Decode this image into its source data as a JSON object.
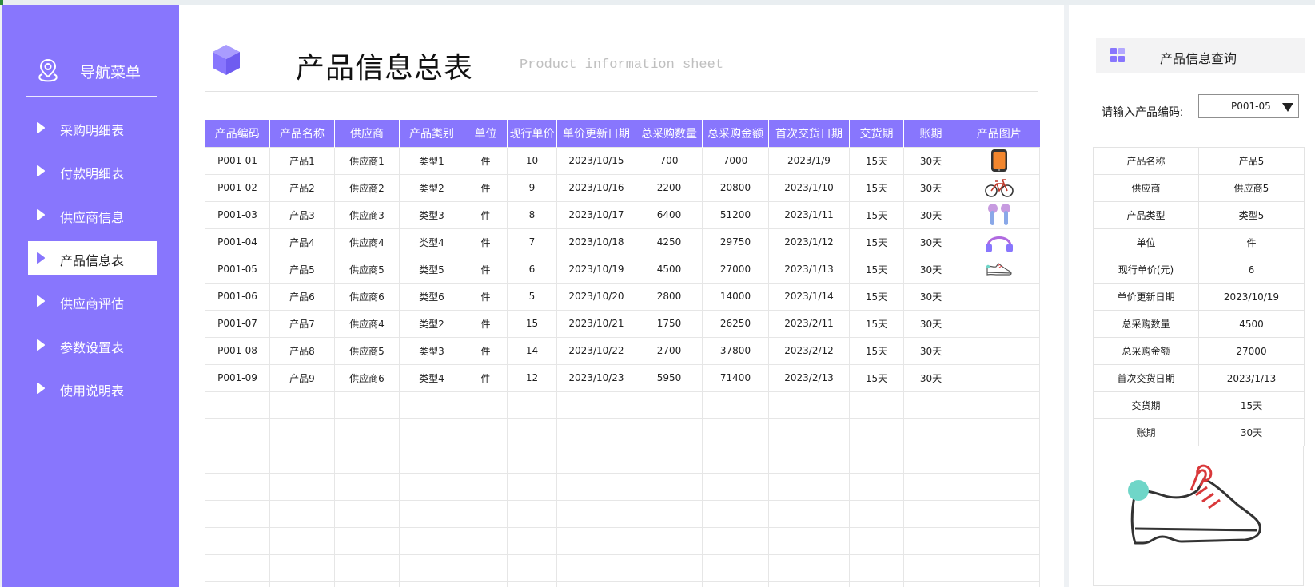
{
  "sidebar": {
    "title": "导航菜单",
    "items": [
      {
        "label": "采购明细表",
        "active": false
      },
      {
        "label": "付款明细表",
        "active": false
      },
      {
        "label": "供应商信息",
        "active": false
      },
      {
        "label": "产品信息表",
        "active": true
      },
      {
        "label": "供应商评估",
        "active": false
      },
      {
        "label": "参数设置表",
        "active": false
      },
      {
        "label": "使用说明表",
        "active": false
      }
    ]
  },
  "header": {
    "title": "产品信息总表",
    "subtitle": "Product information sheet"
  },
  "table": {
    "columns": [
      "产品编码",
      "产品名称",
      "供应商",
      "产品类别",
      "单位",
      "现行单价",
      "单价更新日期",
      "总采购数量",
      "总采购金额",
      "首次交货日期",
      "交货期",
      "账期",
      "产品图片"
    ],
    "rows": [
      {
        "code": "P001-01",
        "name": "产品1",
        "supplier": "供应商1",
        "category": "类型1",
        "unit": "件",
        "price": "10",
        "updated": "2023/10/15",
        "qty": "700",
        "amount": "7000",
        "first_delivery": "2023/1/9",
        "lead": "15天",
        "terms": "30天",
        "image": "phone-icon"
      },
      {
        "code": "P001-02",
        "name": "产品2",
        "supplier": "供应商2",
        "category": "类型2",
        "unit": "件",
        "price": "9",
        "updated": "2023/10/16",
        "qty": "2200",
        "amount": "20800",
        "first_delivery": "2023/1/10",
        "lead": "15天",
        "terms": "30天",
        "image": "bicycle-icon"
      },
      {
        "code": "P001-03",
        "name": "产品3",
        "supplier": "供应商3",
        "category": "类型3",
        "unit": "件",
        "price": "8",
        "updated": "2023/10/17",
        "qty": "6400",
        "amount": "51200",
        "first_delivery": "2023/1/11",
        "lead": "15天",
        "terms": "30天",
        "image": "earbuds-icon"
      },
      {
        "code": "P001-04",
        "name": "产品4",
        "supplier": "供应商4",
        "category": "类型4",
        "unit": "件",
        "price": "7",
        "updated": "2023/10/18",
        "qty": "4250",
        "amount": "29750",
        "first_delivery": "2023/1/12",
        "lead": "15天",
        "terms": "30天",
        "image": "headphones-icon"
      },
      {
        "code": "P001-05",
        "name": "产品5",
        "supplier": "供应商5",
        "category": "类型5",
        "unit": "件",
        "price": "6",
        "updated": "2023/10/19",
        "qty": "4500",
        "amount": "27000",
        "first_delivery": "2023/1/13",
        "lead": "15天",
        "terms": "30天",
        "image": "shoe-icon"
      },
      {
        "code": "P001-06",
        "name": "产品6",
        "supplier": "供应商6",
        "category": "类型6",
        "unit": "件",
        "price": "5",
        "updated": "2023/10/20",
        "qty": "2800",
        "amount": "14000",
        "first_delivery": "2023/1/14",
        "lead": "15天",
        "terms": "30天",
        "image": ""
      },
      {
        "code": "P001-07",
        "name": "产品7",
        "supplier": "供应商4",
        "category": "类型2",
        "unit": "件",
        "price": "15",
        "updated": "2023/10/21",
        "qty": "1750",
        "amount": "26250",
        "first_delivery": "2023/2/11",
        "lead": "15天",
        "terms": "30天",
        "image": ""
      },
      {
        "code": "P001-08",
        "name": "产品8",
        "supplier": "供应商5",
        "category": "类型3",
        "unit": "件",
        "price": "14",
        "updated": "2023/10/22",
        "qty": "2700",
        "amount": "37800",
        "first_delivery": "2023/2/12",
        "lead": "15天",
        "terms": "30天",
        "image": ""
      },
      {
        "code": "P001-09",
        "name": "产品9",
        "supplier": "供应商6",
        "category": "类型4",
        "unit": "件",
        "price": "12",
        "updated": "2023/10/23",
        "qty": "5950",
        "amount": "71400",
        "first_delivery": "2023/2/13",
        "lead": "15天",
        "terms": "30天",
        "image": ""
      }
    ]
  },
  "query": {
    "title": "产品信息查询",
    "label": "请输入产品编码:",
    "selected": "P001-05",
    "details": [
      {
        "label": "产品名称",
        "value": "产品5"
      },
      {
        "label": "供应商",
        "value": "供应商5"
      },
      {
        "label": "产品类型",
        "value": "类型5"
      },
      {
        "label": "单位",
        "value": "件"
      },
      {
        "label": "现行单价(元)",
        "value": "6"
      },
      {
        "label": "单价更新日期",
        "value": "2023/10/19"
      },
      {
        "label": "总采购数量",
        "value": "4500"
      },
      {
        "label": "总采购金额",
        "value": "27000"
      },
      {
        "label": "首次交货日期",
        "value": "2023/1/13"
      },
      {
        "label": "交货期",
        "value": "15天"
      },
      {
        "label": "账期",
        "value": "30天"
      }
    ],
    "image": "shoe-icon"
  },
  "colors": {
    "accent": "#8876fd",
    "sidebar_bg": "#8876fd",
    "shoe_toe": "#6fd6c8",
    "shoe_lace": "#d9383a"
  }
}
